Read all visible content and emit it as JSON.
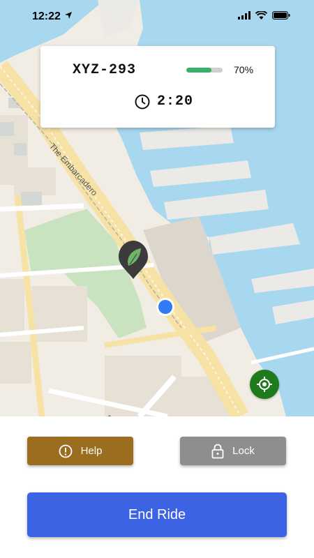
{
  "status_bar": {
    "time": "12:22"
  },
  "ride_card": {
    "plate": "XYZ-293",
    "battery_level": 0.7,
    "battery_text": "70%",
    "elapsed": "2:20"
  },
  "map": {
    "street_label": "The Embarcadero",
    "street_label_2": "S"
  },
  "buttons": {
    "help_label": "Help",
    "lock_label": "Lock",
    "end_label": "End Ride"
  },
  "colors": {
    "help": "#9b6e1f",
    "lock": "#8e8e8e",
    "end": "#3d63e5",
    "battery": "#3aaf6a",
    "water": "#a8d8f0",
    "recenter": "#1d7a1d",
    "scooter_pin": "#3b3b3b",
    "user_dot": "#2f7cf6"
  },
  "icons": {
    "location_arrow": "location-arrow-icon",
    "signal": "cellular-signal-icon",
    "wifi": "wifi-icon",
    "battery": "battery-icon",
    "clock": "clock-icon",
    "help": "exclamation-circle-icon",
    "lock": "padlock-icon",
    "recenter": "crosshair-icon",
    "scooter": "leaf-pin-icon"
  }
}
